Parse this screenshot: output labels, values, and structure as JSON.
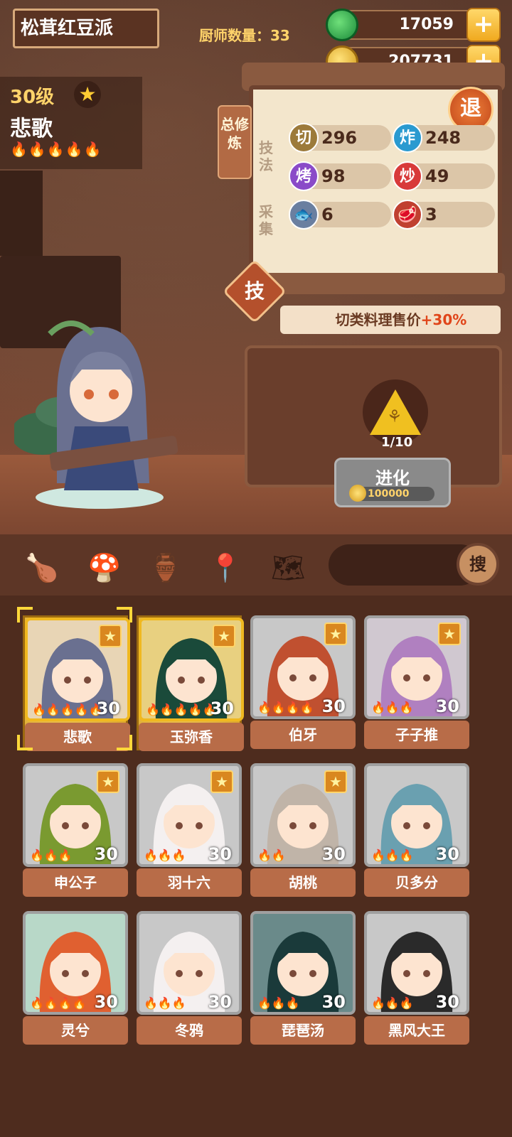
{
  "header": {
    "shop_name": "松茸红豆派",
    "chef_count": "厨师数量：33",
    "jade": "17059",
    "gold": "207731",
    "plus": "+"
  },
  "chef": {
    "level": "30级",
    "name": "悲歌",
    "flames": "🔥🔥🔥🔥🔥"
  },
  "panel": {
    "train_tag": "总修炼",
    "retreat": "退",
    "skill_label": "技法",
    "gather_label": "采集",
    "stats": [
      {
        "icon": "切",
        "value": "296",
        "color": "#9c7a3a"
      },
      {
        "icon": "炸",
        "value": "248",
        "color": "#2a9ad0"
      },
      {
        "icon": "烤",
        "value": "98",
        "color": "#8a4ac8"
      },
      {
        "icon": "炒",
        "value": "49",
        "color": "#d83a3a"
      },
      {
        "icon": "🐟",
        "value": "6",
        "color": "#6a7fa0"
      },
      {
        "icon": "🥩",
        "value": "3",
        "color": "#c04030"
      }
    ],
    "skill_button": "技",
    "bonus_text": "切类料理售价",
    "bonus_value": "+30%"
  },
  "evolve": {
    "count": "1/10",
    "label": "进化",
    "cost": "100000"
  },
  "toolbar": {
    "search": "搜"
  },
  "chefs": [
    {
      "name": "悲歌",
      "level": "30",
      "flames": "🔥🔥🔥🔥🔥",
      "gold": true,
      "star": true,
      "bg": "#e8d5b5",
      "hair": "#6a7090"
    },
    {
      "name": "玉弥香",
      "level": "30",
      "flames": "🔥🔥🔥🔥🔥",
      "gold": true,
      "star": true,
      "bg": "#e8d080",
      "hair": "#1a4a3a"
    },
    {
      "name": "伯牙",
      "level": "30",
      "flames": "🔥🔥🔥🔥",
      "gold": false,
      "star": true,
      "bg": "#c8c8c8",
      "hair": "#c05030"
    },
    {
      "name": "子子推",
      "level": "30",
      "flames": "🔥🔥🔥",
      "gold": false,
      "star": true,
      "bg": "#d0c8d0",
      "hair": "#b080c0"
    },
    {
      "name": "申公子",
      "level": "30",
      "flames": "🔥🔥🔥",
      "gold": false,
      "star": true,
      "bg": "#c8c8c8",
      "hair": "#7a9a30"
    },
    {
      "name": "羽十六",
      "level": "30",
      "flames": "🔥🔥🔥",
      "gold": false,
      "star": true,
      "bg": "#c8c8c8",
      "hair": "#f4f0f0"
    },
    {
      "name": "胡桃",
      "level": "30",
      "flames": "🔥🔥",
      "gold": false,
      "star": true,
      "bg": "#c8c8c8",
      "hair": "#c0b4a8"
    },
    {
      "name": "贝多分",
      "level": "30",
      "flames": "🔥🔥🔥",
      "gold": false,
      "star": false,
      "bg": "#c8c8c8",
      "hair": "#6aa0b0"
    },
    {
      "name": "灵兮",
      "level": "30",
      "flames": "🔥🔥🔥🔥",
      "gold": false,
      "star": false,
      "bg": "#b8d8c8",
      "hair": "#e06030"
    },
    {
      "name": "冬鸦",
      "level": "30",
      "flames": "🔥🔥🔥",
      "gold": false,
      "star": false,
      "bg": "#c8c8c8",
      "hair": "#f4f0f0"
    },
    {
      "name": "琵琶汤",
      "level": "30",
      "flames": "🔥🔥🔥",
      "gold": false,
      "star": false,
      "bg": "#6a8a8a",
      "hair": "#1a3a3a"
    },
    {
      "name": "黑风大王",
      "level": "30",
      "flames": "🔥🔥🔥",
      "gold": false,
      "star": false,
      "bg": "#c8c8c8",
      "hair": "#2a2a2a"
    }
  ]
}
